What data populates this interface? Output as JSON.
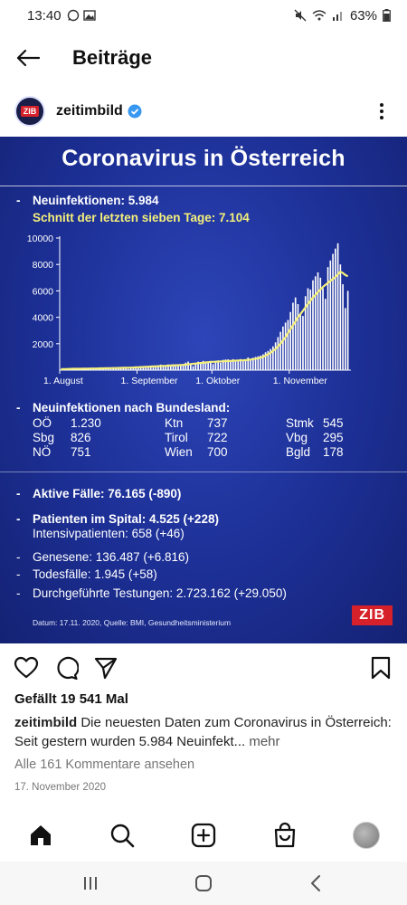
{
  "status": {
    "time": "13:40",
    "battery": "63%",
    "left_icons": [
      "whatsapp-icon",
      "image-icon"
    ],
    "right_icons": [
      "mute-icon",
      "wifi-icon",
      "signal-icon",
      "battery-icon"
    ]
  },
  "appbar": {
    "title": "Beiträge"
  },
  "post": {
    "username": "zeitimbild",
    "avatar_text": "ZIB",
    "infographic": {
      "title": "Coronavirus in Österreich",
      "new_infections_label": "Neuinfektionen: 5.984",
      "seven_day_label": "Schnitt der letzten sieben Tage: 7.104",
      "by_state_label": "Neuinfektionen nach Bundesland:",
      "states": [
        {
          "name": "OÖ",
          "value": "1.230"
        },
        {
          "name": "Ktn",
          "value": "737"
        },
        {
          "name": "Stmk",
          "value": "545"
        },
        {
          "name": "Sbg",
          "value": "826"
        },
        {
          "name": "Tirol",
          "value": "722"
        },
        {
          "name": "Vbg",
          "value": "295"
        },
        {
          "name": "NÖ",
          "value": "751"
        },
        {
          "name": "Wien",
          "value": "700"
        },
        {
          "name": "Bgld",
          "value": "178"
        }
      ],
      "active_cases": "Aktive Fälle: 76.165 (-890)",
      "hospital": "Patienten im Spital: 4.525 (+228)",
      "icu": "Intensivpatienten: 658 (+46)",
      "recovered": "Genesene: 136.487 (+6.816)",
      "deaths": "Todesfälle: 1.945 (+58)",
      "tests": "Durchgeführte Testungen: 2.723.162 (+29.050)",
      "source": "Datum: 17.11. 2020, Quelle: BMI, Gesundheitsministerium",
      "logo": "ZIB",
      "bullet": "-"
    },
    "likes": "Gefällt 19 541 Mal",
    "caption": "Die neuesten Daten zum Coronavirus in Österreich: Seit gestern wurden 5.984 Neuinfekt...",
    "more": "mehr",
    "comments_link": "Alle 161 Kommentare ansehen",
    "date": "17. November 2020"
  },
  "chart_data": {
    "type": "bar",
    "title": "",
    "xlabel": "",
    "ylabel": "",
    "ylim": [
      0,
      10000
    ],
    "yticks": [
      2000,
      4000,
      6000,
      8000,
      10000
    ],
    "ytick_labels": [
      "2000",
      "4000",
      "6000",
      "8000",
      "10000"
    ],
    "x_tick_labels": [
      "1. August",
      "1. September",
      "1. Oktober",
      "1. November"
    ],
    "x_tick_index": [
      0,
      31,
      61,
      92
    ],
    "series": [
      {
        "type": "bar",
        "values": [
          50,
          80,
          110,
          60,
          70,
          120,
          90,
          60,
          80,
          140,
          90,
          130,
          120,
          70,
          80,
          150,
          110,
          180,
          140,
          100,
          80,
          190,
          150,
          200,
          120,
          220,
          160,
          90,
          200,
          250,
          270,
          140,
          260,
          190,
          300,
          280,
          350,
          200,
          340,
          290,
          420,
          350,
          310,
          430,
          390,
          440,
          380,
          350,
          430,
          460,
          570,
          650,
          500,
          300,
          520,
          640,
          610,
          700,
          520,
          650,
          600,
          460,
          710,
          740,
          560,
          780,
          810,
          820,
          650,
          830,
          680,
          750,
          840,
          720,
          800,
          960,
          860,
          940,
          1000,
          1050,
          1100,
          1200,
          1350,
          1450,
          1600,
          1800,
          2100,
          2500,
          2900,
          3300,
          3600,
          3800,
          4400,
          5100,
          5500,
          5000,
          4200,
          4100,
          5600,
          6200,
          6100,
          6800,
          7100,
          7400,
          7000,
          6200,
          5400,
          7800,
          8300,
          8800,
          9200,
          9600,
          8000,
          6500,
          4700,
          6000
        ]
      },
      {
        "type": "line",
        "values": [
          70,
          80,
          85,
          90,
          95,
          100,
          100,
          100,
          105,
          110,
          110,
          115,
          120,
          120,
          125,
          130,
          135,
          140,
          145,
          150,
          150,
          155,
          160,
          165,
          170,
          175,
          180,
          185,
          190,
          200,
          210,
          220,
          230,
          240,
          250,
          260,
          270,
          280,
          290,
          300,
          310,
          320,
          330,
          340,
          350,
          360,
          370,
          380,
          390,
          400,
          420,
          440,
          460,
          480,
          500,
          520,
          540,
          560,
          580,
          600,
          620,
          630,
          640,
          650,
          660,
          670,
          680,
          690,
          700,
          710,
          720,
          730,
          740,
          750,
          760,
          780,
          800,
          830,
          860,
          900,
          950,
          1000,
          1100,
          1200,
          1300,
          1450,
          1600,
          1800,
          2000,
          2250,
          2500,
          2800,
          3100,
          3400,
          3700,
          4000,
          4250,
          4500,
          4750,
          5000,
          5250,
          5500,
          5700,
          5900,
          6100,
          6300,
          6450,
          6600,
          6750,
          6900,
          7050,
          7250,
          7450,
          7350,
          7200,
          7104
        ]
      }
    ],
    "grid": false,
    "legend": "none"
  },
  "colors": {
    "infographic_bg": "#1c2f95",
    "highlight": "#f5f07a",
    "brand_red": "#d6212a",
    "verified_blue": "#3897f0"
  },
  "icons": {
    "back": "arrow-left-icon",
    "verified": "verified-badge-icon",
    "more": "kebab-icon",
    "like": "heart-icon",
    "comment": "comment-icon",
    "share": "send-icon",
    "save": "bookmark-icon",
    "home": "home-icon",
    "search": "search-icon",
    "create": "plus-square-icon",
    "shop": "shopping-bag-icon",
    "profile": "profile-avatar-icon",
    "recents": "recents-icon",
    "android_home": "android-home-icon",
    "android_back": "android-back-icon"
  }
}
